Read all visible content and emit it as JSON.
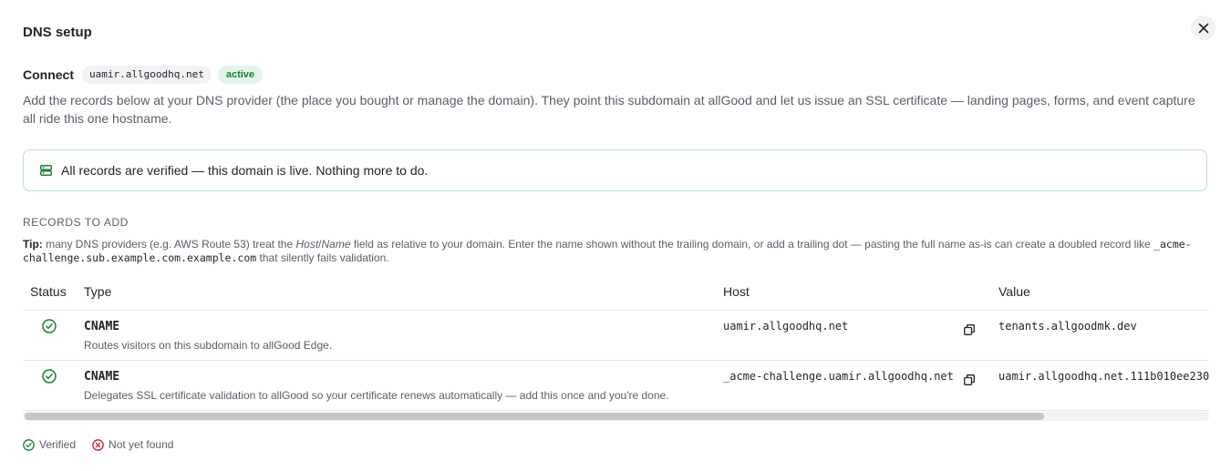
{
  "dialog": {
    "title": "DNS setup",
    "connect_label": "Connect",
    "domain": "uamir.allgoodhq.net",
    "status_badge": "active",
    "description": "Add the records below at your DNS provider (the place you bought or manage the domain). They point this subdomain at allGood and let us issue an SSL certificate — landing pages, forms, and event capture all ride this one hostname.",
    "banner": "All records are verified — this domain is live. Nothing more to do.",
    "section_title": "RECORDS TO ADD"
  },
  "tip": {
    "label": "Tip:",
    "text_1": "many DNS providers (e.g. AWS Route 53) treat the",
    "host_word": "Host",
    "slash": "/",
    "name_word": "Name",
    "text_2": "field as relative to your domain. Enter the name shown without the trailing domain, or add a trailing dot — pasting the full name as-is can create a doubled record like",
    "example": "_acme-challenge.sub.example.com.example.com",
    "text_3": "that silently fails validation."
  },
  "table": {
    "headers": [
      "Status",
      "Type",
      "Host",
      "Value"
    ],
    "rows": [
      {
        "type": "CNAME",
        "description": "Routes visitors on this subdomain to allGood Edge.",
        "host": "uamir.allgoodhq.net",
        "value": "tenants.allgoodmk.dev",
        "status": "verified"
      },
      {
        "type": "CNAME",
        "description": "Delegates SSL certificate validation to allGood so your certificate renews automatically — add this once and you're done.",
        "host": "_acme-challenge.uamir.allgoodhq.net",
        "value": "uamir.allgoodhq.net.111b010ee230",
        "status": "verified"
      }
    ]
  },
  "legend": {
    "verified": "Verified",
    "not_found": "Not yet found"
  },
  "colors": {
    "success": "#1a7f37",
    "error": "#cf222e",
    "banner_border": "#b6e3c2"
  },
  "icons": {
    "close": "close-icon",
    "banner": "server-icon",
    "status": "check-circle-icon",
    "copy": "copy-icon",
    "error": "x-circle-icon"
  }
}
